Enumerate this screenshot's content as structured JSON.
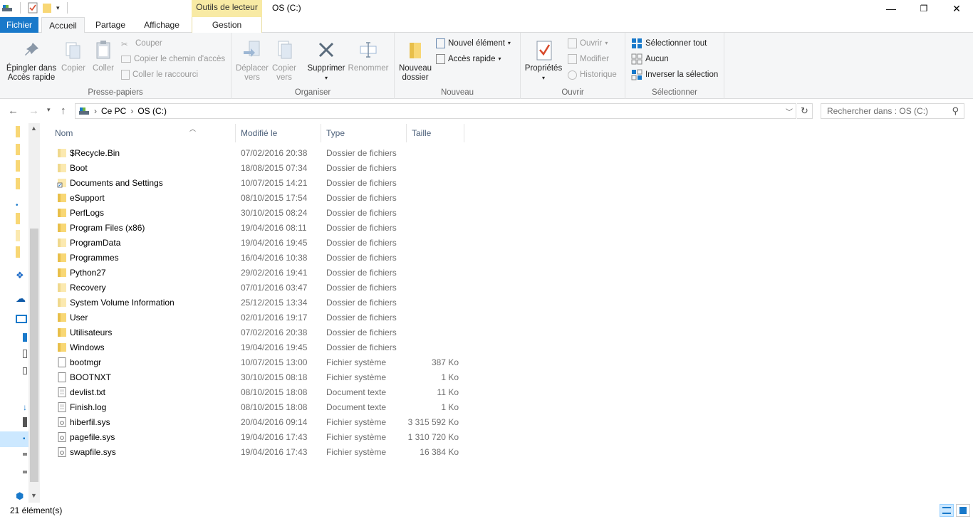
{
  "window": {
    "title": "OS (C:)",
    "contextual_tab_group": "Outils de lecteur"
  },
  "tabs": {
    "file": "Fichier",
    "home": "Accueil",
    "share": "Partage",
    "view": "Affichage",
    "manage": "Gestion"
  },
  "ribbon": {
    "clipboard": {
      "label": "Presse-papiers",
      "pin": "Épingler dans\nAccès rapide",
      "pin_l1": "Épingler dans",
      "pin_l2": "Accès rapide",
      "copy": "Copier",
      "paste": "Coller",
      "cut": "Couper",
      "copy_path": "Copier le chemin d'accès",
      "paste_shortcut": "Coller le raccourci"
    },
    "organize": {
      "label": "Organiser",
      "move_l1": "Déplacer",
      "move_l2": "vers",
      "copyto_l1": "Copier",
      "copyto_l2": "vers",
      "delete": "Supprimer",
      "rename": "Renommer"
    },
    "new": {
      "label": "Nouveau",
      "folder_l1": "Nouveau",
      "folder_l2": "dossier",
      "new_item": "Nouvel élément",
      "quick_access": "Accès rapide"
    },
    "open": {
      "label": "Ouvrir",
      "properties": "Propriétés",
      "open": "Ouvrir",
      "edit": "Modifier",
      "history": "Historique"
    },
    "select": {
      "label": "Sélectionner",
      "select_all": "Sélectionner tout",
      "select_none": "Aucun",
      "invert": "Inverser la sélection"
    }
  },
  "address": {
    "crumbs": [
      "Ce PC",
      "OS (C:)"
    ],
    "search_placeholder": "Rechercher dans : OS (C:)"
  },
  "columns": {
    "name": "Nom",
    "modified": "Modifié le",
    "type": "Type",
    "size": "Taille"
  },
  "files": [
    {
      "name": "$Recycle.Bin",
      "date": "07/02/2016 20:38",
      "type": "Dossier de fichiers",
      "size": "",
      "icon": "folder-light-icon"
    },
    {
      "name": "Boot",
      "date": "18/08/2015 07:34",
      "type": "Dossier de fichiers",
      "size": "",
      "icon": "folder-light-icon"
    },
    {
      "name": "Documents and Settings",
      "date": "10/07/2015 14:21",
      "type": "Dossier de fichiers",
      "size": "",
      "icon": "folder-shortcut-icon"
    },
    {
      "name": "eSupport",
      "date": "08/10/2015 17:54",
      "type": "Dossier de fichiers",
      "size": "",
      "icon": "folder-icon"
    },
    {
      "name": "PerfLogs",
      "date": "30/10/2015 08:24",
      "type": "Dossier de fichiers",
      "size": "",
      "icon": "folder-icon"
    },
    {
      "name": "Program Files (x86)",
      "date": "19/04/2016 08:11",
      "type": "Dossier de fichiers",
      "size": "",
      "icon": "folder-icon"
    },
    {
      "name": "ProgramData",
      "date": "19/04/2016 19:45",
      "type": "Dossier de fichiers",
      "size": "",
      "icon": "folder-light-icon"
    },
    {
      "name": "Programmes",
      "date": "16/04/2016 10:38",
      "type": "Dossier de fichiers",
      "size": "",
      "icon": "folder-icon"
    },
    {
      "name": "Python27",
      "date": "29/02/2016 19:41",
      "type": "Dossier de fichiers",
      "size": "",
      "icon": "folder-icon"
    },
    {
      "name": "Recovery",
      "date": "07/01/2016 03:47",
      "type": "Dossier de fichiers",
      "size": "",
      "icon": "folder-light-icon"
    },
    {
      "name": "System Volume Information",
      "date": "25/12/2015 13:34",
      "type": "Dossier de fichiers",
      "size": "",
      "icon": "folder-light-icon"
    },
    {
      "name": "User",
      "date": "02/01/2016 19:17",
      "type": "Dossier de fichiers",
      "size": "",
      "icon": "folder-icon"
    },
    {
      "name": "Utilisateurs",
      "date": "07/02/2016 20:38",
      "type": "Dossier de fichiers",
      "size": "",
      "icon": "folder-icon"
    },
    {
      "name": "Windows",
      "date": "19/04/2016 19:45",
      "type": "Dossier de fichiers",
      "size": "",
      "icon": "folder-icon"
    },
    {
      "name": "bootmgr",
      "date": "10/07/2015 13:00",
      "type": "Fichier système",
      "size": "387 Ko",
      "icon": "file-icon"
    },
    {
      "name": "BOOTNXT",
      "date": "30/10/2015 08:18",
      "type": "Fichier système",
      "size": "1 Ko",
      "icon": "file-icon"
    },
    {
      "name": "devlist.txt",
      "date": "08/10/2015 18:08",
      "type": "Document texte",
      "size": "11 Ko",
      "icon": "text-file-icon"
    },
    {
      "name": "Finish.log",
      "date": "08/10/2015 18:08",
      "type": "Document texte",
      "size": "1 Ko",
      "icon": "text-file-icon"
    },
    {
      "name": "hiberfil.sys",
      "date": "20/04/2016 09:14",
      "type": "Fichier système",
      "size": "3 315 592 Ko",
      "icon": "system-file-icon"
    },
    {
      "name": "pagefile.sys",
      "date": "19/04/2016 17:43",
      "type": "Fichier système",
      "size": "1 310 720 Ko",
      "icon": "system-file-icon"
    },
    {
      "name": "swapfile.sys",
      "date": "19/04/2016 17:43",
      "type": "Fichier système",
      "size": "16 384 Ko",
      "icon": "system-file-icon"
    }
  ],
  "status": {
    "count": "21 élément(s)"
  },
  "colors": {
    "accent": "#1979ca",
    "contextual": "#f8eaa4",
    "folder": "#f8d775",
    "folder_light": "#fbe9b0",
    "selection": "#cce8ff"
  }
}
